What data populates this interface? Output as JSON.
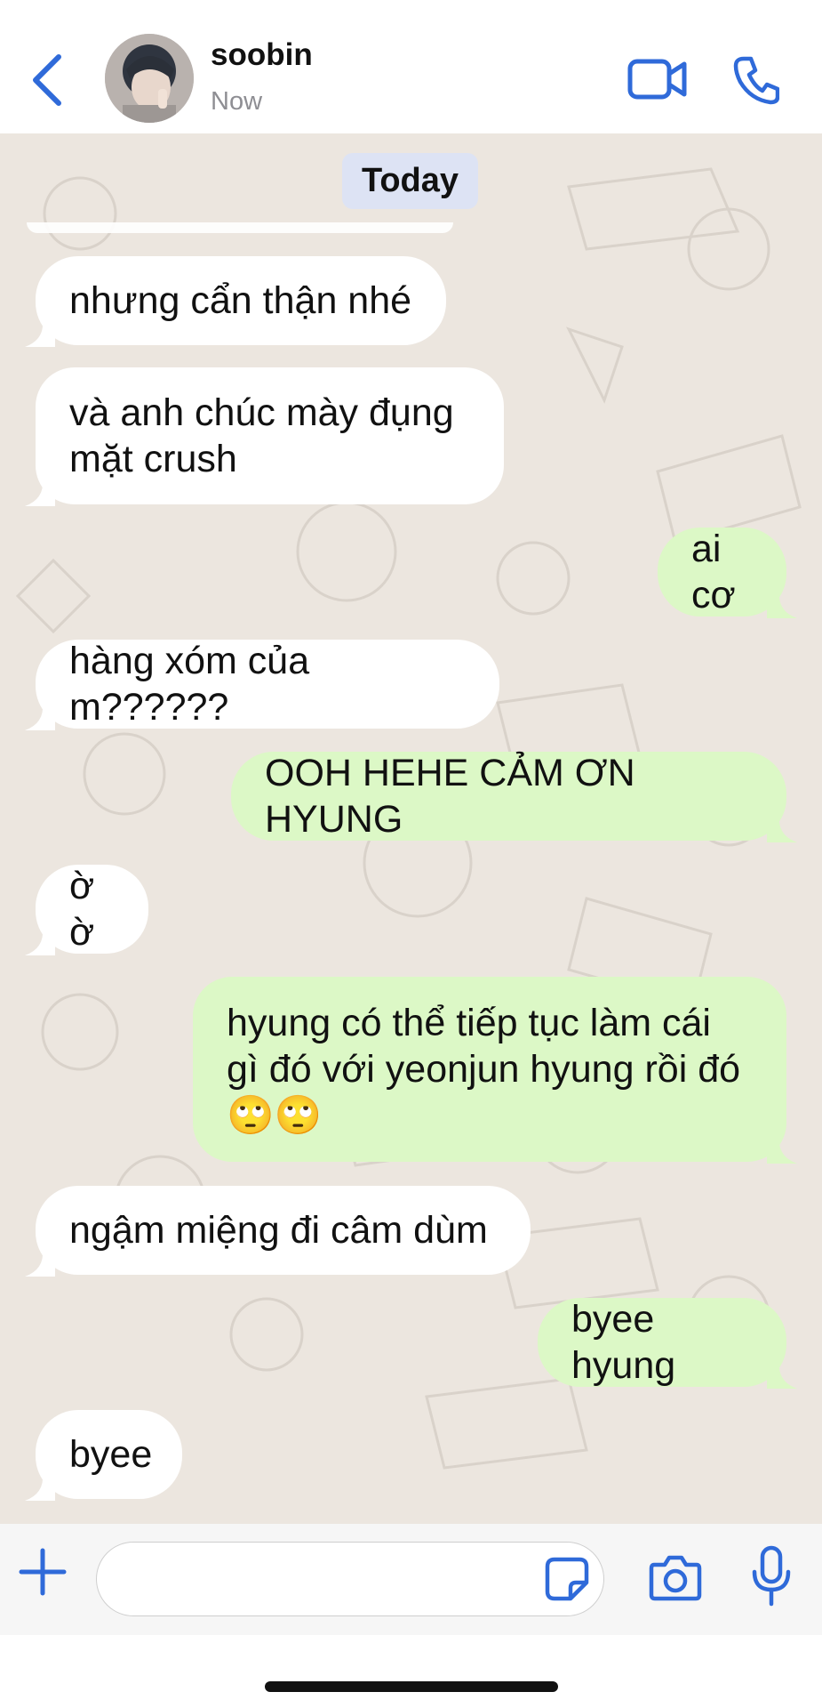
{
  "header": {
    "contact_name": "soobin",
    "status": "Now",
    "icons": {
      "back": "chevron-left-icon",
      "video": "video-camera-icon",
      "phone": "phone-icon"
    },
    "accent_color": "#2f6ad9"
  },
  "chat": {
    "date_label": "Today",
    "wallpaper_color": "#ece6df",
    "incoming_color": "#ffffff",
    "outgoing_color": "#dcf8c6",
    "messages": [
      {
        "direction": "in",
        "text": "nhưng cẩn thận nhé"
      },
      {
        "direction": "in",
        "text": "và anh chúc mày đụng mặt crush"
      },
      {
        "direction": "out",
        "text": "ai cơ"
      },
      {
        "direction": "in",
        "text": "hàng xóm của m??????"
      },
      {
        "direction": "out",
        "text": "OOH HEHE CẢM ƠN HYUNG"
      },
      {
        "direction": "in",
        "text": "ờ ờ"
      },
      {
        "direction": "out",
        "text": "hyung có thể tiếp tục làm cái gì đó với yeonjun hyung rồi đó 🙄🙄"
      },
      {
        "direction": "in",
        "text": "ngậm miệng đi câm dùm"
      },
      {
        "direction": "out",
        "text": "byee hyung"
      },
      {
        "direction": "in",
        "text": "byee"
      }
    ]
  },
  "input_bar": {
    "placeholder": "",
    "icons": {
      "add": "plus-icon",
      "sticker": "sticker-icon",
      "camera": "camera-icon",
      "mic": "microphone-icon"
    }
  }
}
